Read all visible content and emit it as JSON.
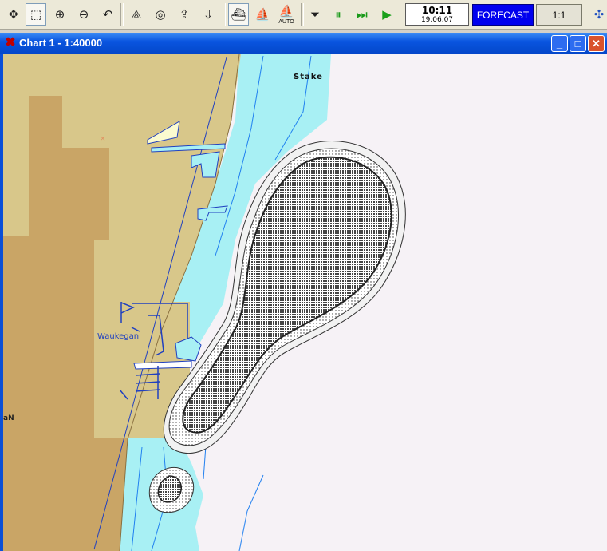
{
  "toolbar": {
    "tools": [
      {
        "name": "pan-tool",
        "glyph": "✥"
      },
      {
        "name": "select-tool",
        "glyph": "⬚"
      },
      {
        "name": "zoom-in-tool",
        "glyph": "⊕"
      },
      {
        "name": "zoom-out-tool",
        "glyph": "⊖"
      },
      {
        "name": "undo-tool",
        "glyph": "↶"
      },
      {
        "name": "route-tool",
        "glyph": "⟁"
      },
      {
        "name": "target-tool",
        "glyph": "◎"
      },
      {
        "name": "export-tool",
        "glyph": "⇪"
      },
      {
        "name": "import-tool",
        "glyph": "⇩"
      },
      {
        "name": "ship-mode",
        "glyph": "⛴"
      },
      {
        "name": "ship-outline-mode",
        "glyph": "⛵"
      },
      {
        "name": "auto-mode",
        "glyph": "⛵",
        "sub": "AUTO"
      },
      {
        "name": "stop-control",
        "glyph": "⏷"
      },
      {
        "name": "pause-control",
        "glyph": "⏸"
      },
      {
        "name": "fast-forward-control",
        "glyph": "⏭"
      },
      {
        "name": "play-control",
        "glyph": "▶"
      }
    ],
    "time": "10:11",
    "date": "19.06.07",
    "forecast_label": "FORECAST",
    "scale_label": "1:1"
  },
  "window": {
    "title": "Chart 1 - 1:40000",
    "minimize": "_",
    "maximize": "□",
    "close": "✕"
  },
  "map": {
    "labels": {
      "stake": "Stake",
      "town": "Waukegan",
      "edge_fragment": "aN"
    },
    "colors": {
      "land_dark": "#c9a566",
      "land_light": "#d8c78a",
      "shallow_water": "#a8f0f4",
      "deep_water": "#f6f2f6",
      "contour": "#2040c0",
      "shoal": "#444444"
    }
  }
}
